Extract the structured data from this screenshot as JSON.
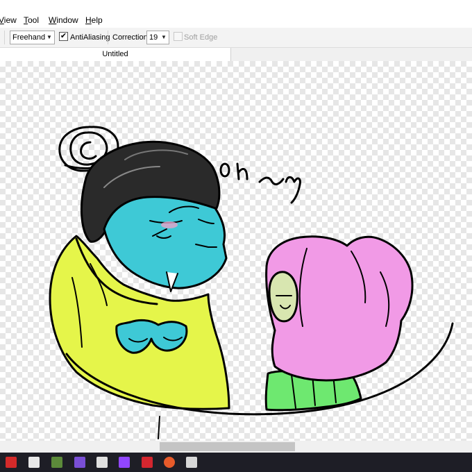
{
  "menu": {
    "items": [
      {
        "label": "View",
        "underline": "V",
        "rest": "iew"
      },
      {
        "label": "Tool",
        "underline": "T",
        "rest": "ool"
      },
      {
        "label": "Window",
        "underline": "W",
        "rest": "indow"
      },
      {
        "label": "Help",
        "underline": "H",
        "rest": "elp"
      }
    ]
  },
  "toolbar": {
    "brush_mode": "Freehand",
    "antialiasing": {
      "label": "AntiAliasing",
      "checked": true
    },
    "correction": {
      "label": "Correction",
      "value": "19"
    },
    "soft_edge": {
      "label": "Soft Edge",
      "checked": false,
      "enabled": false
    }
  },
  "tabs": [
    {
      "label": "Untitled",
      "active": true
    }
  ],
  "canvas": {
    "handwriting": "Oh my"
  },
  "taskbar": {
    "icons": [
      {
        "name": "flag-icon",
        "color": "#d42a2a"
      },
      {
        "name": "llama-icon",
        "color": "#e8e8e8"
      },
      {
        "name": "minecraft-icon",
        "color": "#5c8a3a"
      },
      {
        "name": "audio-icon",
        "color": "#7a4fd6"
      },
      {
        "name": "store-icon",
        "color": "#e0e0e0"
      },
      {
        "name": "twitch-icon",
        "color": "#9146ff"
      },
      {
        "name": "app-red-icon",
        "color": "#d4262f"
      },
      {
        "name": "app-orange-icon",
        "color": "#e85b2a"
      },
      {
        "name": "photo-app-icon",
        "color": "#d8d8d8"
      }
    ]
  }
}
